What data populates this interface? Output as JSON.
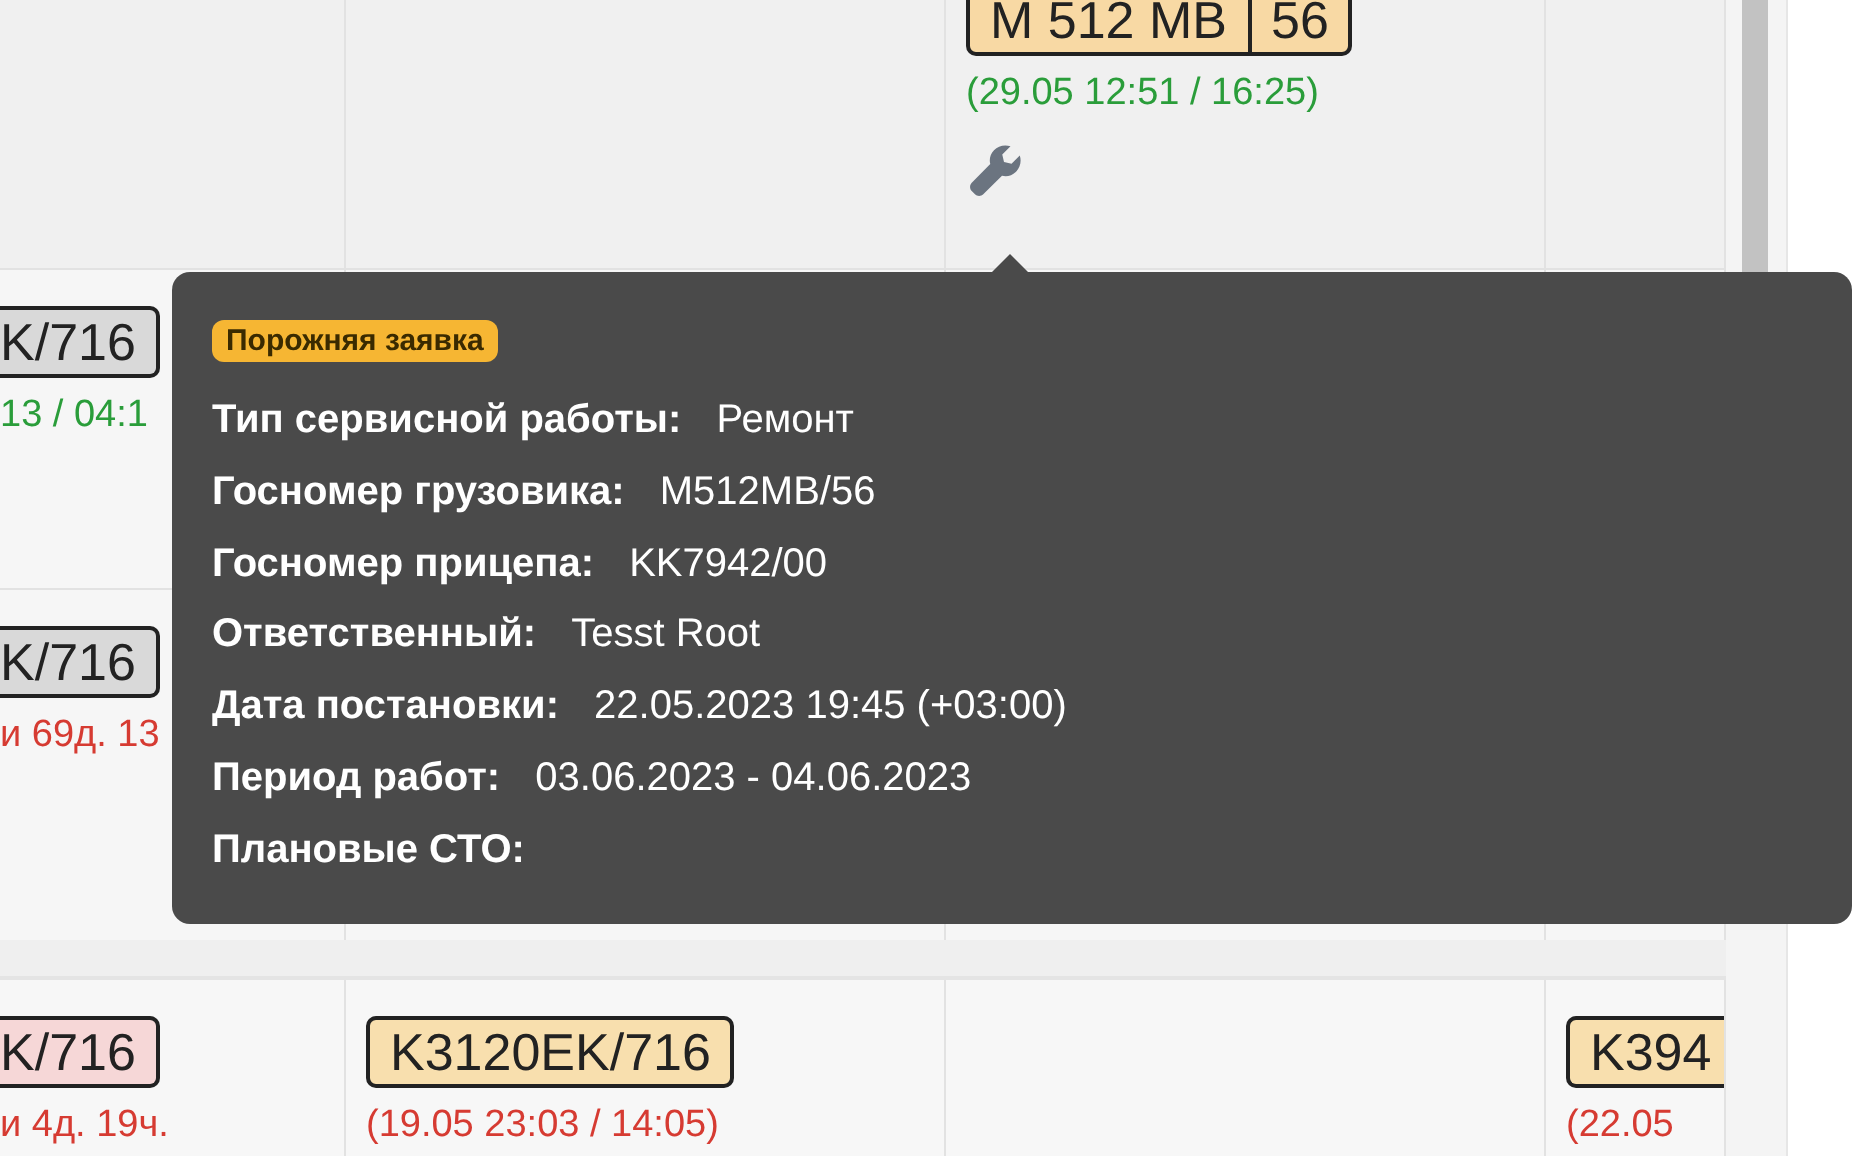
{
  "board": {
    "rows": [
      {
        "cells": [
          null,
          null,
          {
            "plate": "M 512 MB",
            "region": "56",
            "color": "#f8d9a4",
            "time": "(29.05 12:51 / 16:25)",
            "overdue": false,
            "service": true
          },
          null
        ]
      },
      {
        "cells": [
          {
            "plate": "K/716",
            "color": "#d9d9d9",
            "time": "13 / 04:1",
            "overdue": false
          },
          null,
          null,
          null
        ]
      },
      {
        "cells": [
          {
            "plate": "K/716",
            "color": "#d9d9d9",
            "time": "и 69д. 13",
            "overdue": true
          },
          null,
          null,
          null
        ]
      },
      {
        "cells": [
          {
            "plate": "K/716",
            "color": "#f6d7d7",
            "time": "и 4д. 19ч.",
            "overdue": true
          },
          {
            "plate": "K3120EK/716",
            "color": "#f8dfae",
            "time": "(19.05 23:03 / 14:05)",
            "overdue": true
          },
          null,
          {
            "plate": "K394",
            "color": "#f8dfae",
            "time": "(22.05",
            "overdue": true
          }
        ]
      }
    ]
  },
  "tooltip": {
    "badge": "Порожняя заявка",
    "fields": [
      {
        "label": "Тип сервисной работы:",
        "value": "Ремонт"
      },
      {
        "label": "Госномер грузовика:",
        "value": "M512MB/56"
      },
      {
        "label": "Госномер прицепа:",
        "value": "KK7942/00"
      },
      {
        "label": "Ответственный:",
        "value": "Tesst Root"
      },
      {
        "label": "Дата постановки:",
        "value": "22.05.2023 19:45 (+03:00)"
      },
      {
        "label": "Период работ:",
        "value": "03.06.2023 - 04.06.2023"
      },
      {
        "label": "Плановые СТО:"
      }
    ]
  }
}
